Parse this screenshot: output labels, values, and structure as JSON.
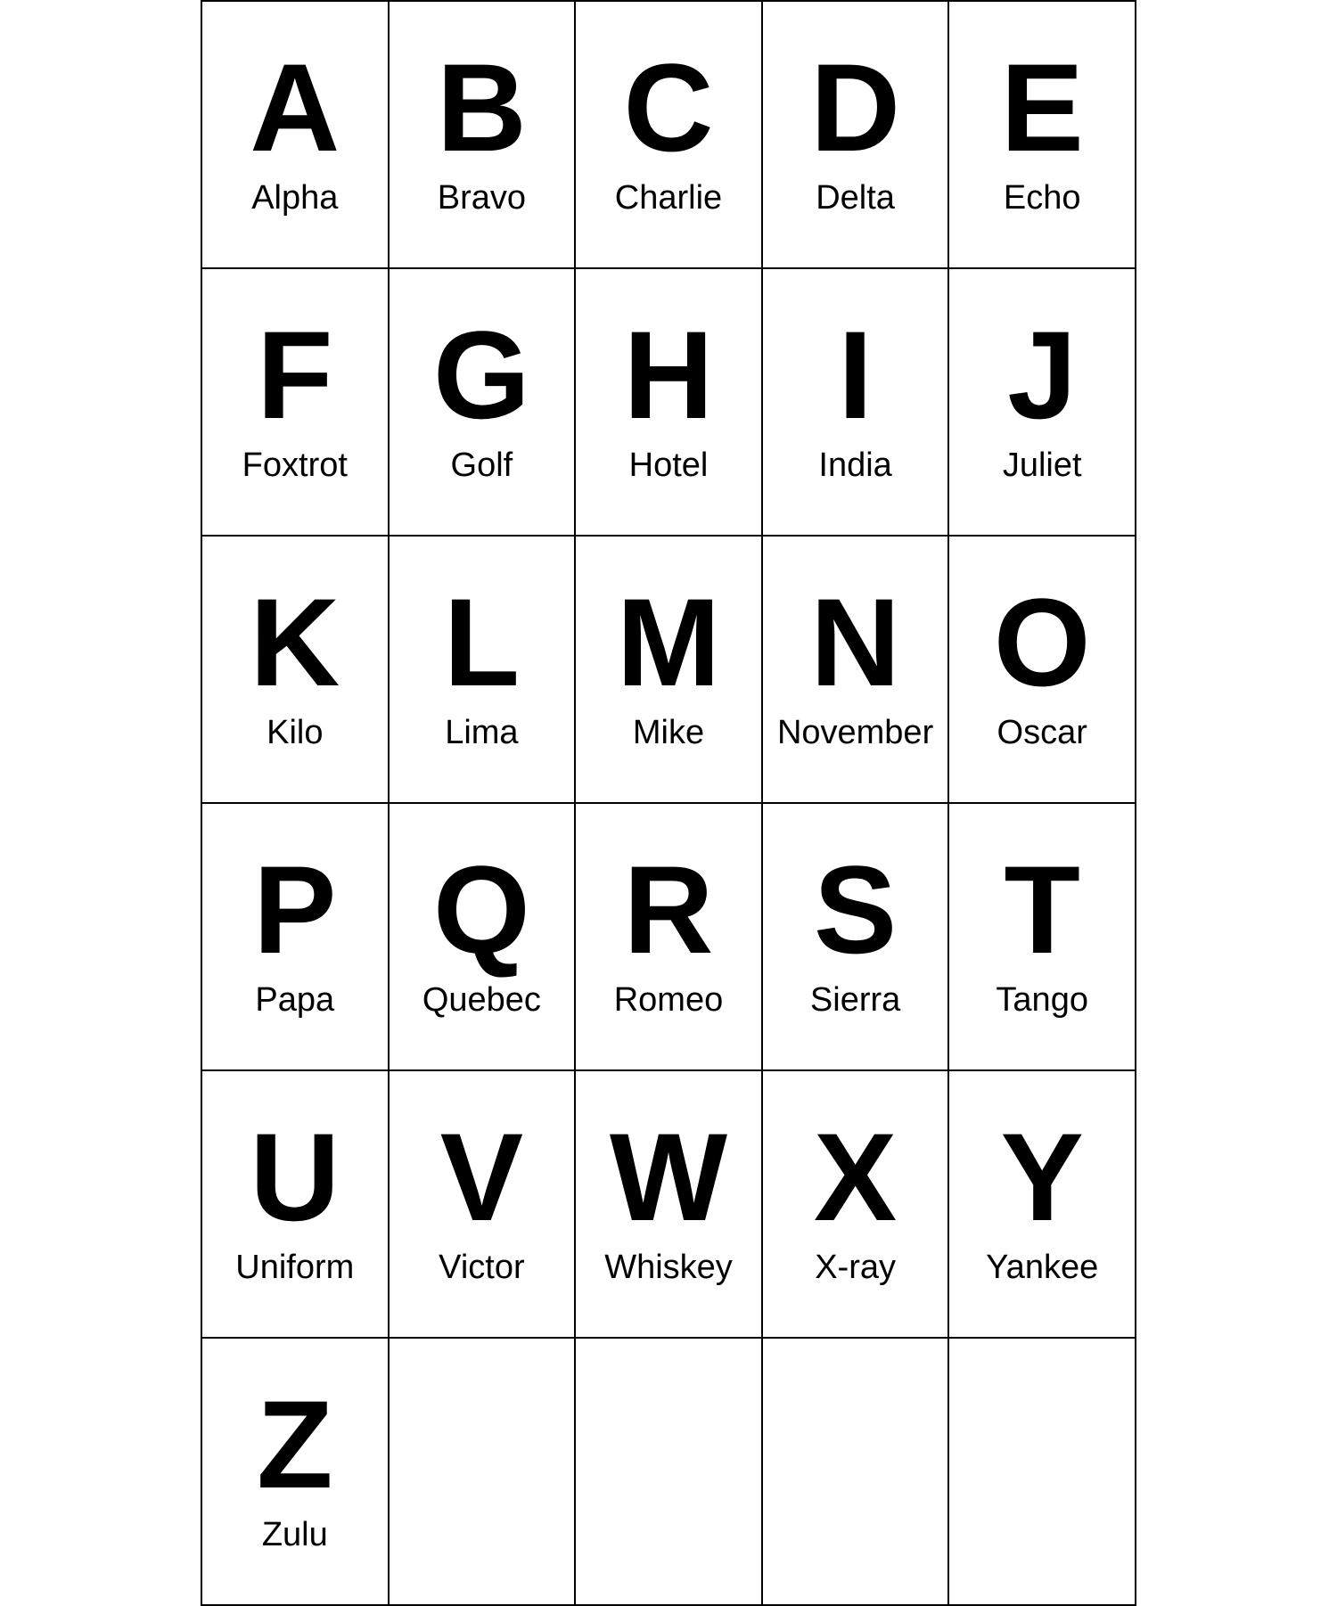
{
  "alphabet": [
    {
      "letter": "A",
      "word": "Alpha"
    },
    {
      "letter": "B",
      "word": "Bravo"
    },
    {
      "letter": "C",
      "word": "Charlie"
    },
    {
      "letter": "D",
      "word": "Delta"
    },
    {
      "letter": "E",
      "word": "Echo"
    },
    {
      "letter": "F",
      "word": "Foxtrot"
    },
    {
      "letter": "G",
      "word": "Golf"
    },
    {
      "letter": "H",
      "word": "Hotel"
    },
    {
      "letter": "I",
      "word": "India"
    },
    {
      "letter": "J",
      "word": "Juliet"
    },
    {
      "letter": "K",
      "word": "Kilo"
    },
    {
      "letter": "L",
      "word": "Lima"
    },
    {
      "letter": "M",
      "word": "Mike"
    },
    {
      "letter": "N",
      "word": "November"
    },
    {
      "letter": "O",
      "word": "Oscar"
    },
    {
      "letter": "P",
      "word": "Papa"
    },
    {
      "letter": "Q",
      "word": "Quebec"
    },
    {
      "letter": "R",
      "word": "Romeo"
    },
    {
      "letter": "S",
      "word": "Sierra"
    },
    {
      "letter": "T",
      "word": "Tango"
    },
    {
      "letter": "U",
      "word": "Uniform"
    },
    {
      "letter": "V",
      "word": "Victor"
    },
    {
      "letter": "W",
      "word": "Whiskey"
    },
    {
      "letter": "X",
      "word": "X-ray"
    },
    {
      "letter": "Y",
      "word": "Yankee"
    },
    {
      "letter": "Z",
      "word": "Zulu"
    }
  ]
}
